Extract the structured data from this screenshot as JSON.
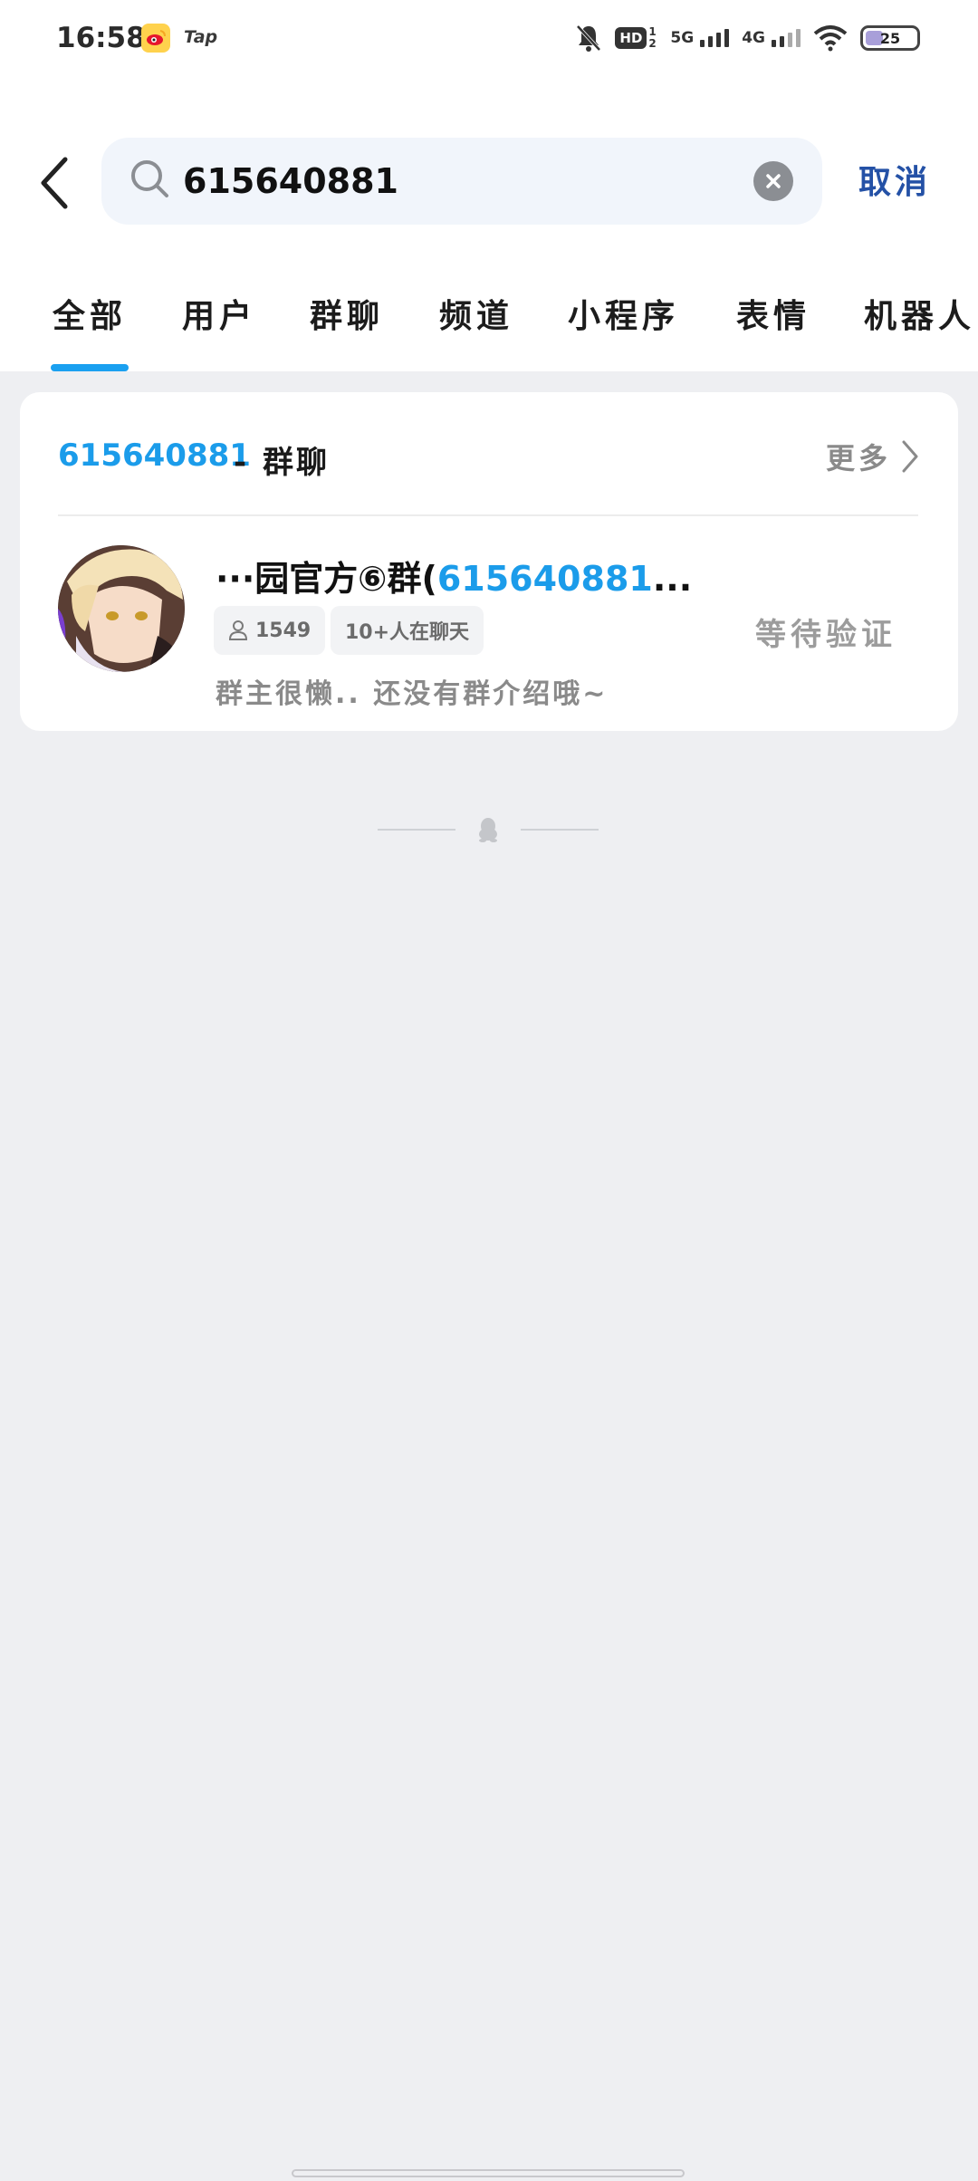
{
  "status_bar": {
    "time": "16:58",
    "tap_label": "Tap",
    "hd_label": "HD",
    "hd_sub": "1 2",
    "net1": "5G",
    "net2": "4G",
    "battery": "25"
  },
  "search": {
    "query": "615640881",
    "cancel_label": "取消"
  },
  "tabs": [
    {
      "label": "全部",
      "active": true
    },
    {
      "label": "用户"
    },
    {
      "label": "群聊"
    },
    {
      "label": "频道"
    },
    {
      "label": "小程序"
    },
    {
      "label": "表情"
    },
    {
      "label": "机器人"
    }
  ],
  "result_section": {
    "query": "615640881",
    "type_label": "- 群聊",
    "more_label": "更多",
    "group": {
      "name_prefix": "···园官方⑥群(",
      "name_highlight": "615640881",
      "name_suffix": "...",
      "member_count": "1549",
      "chatting_label": "10+人在聊天",
      "status": "等待验证",
      "description": "群主很懒.. 还没有群介绍哦~"
    }
  },
  "colors": {
    "accent": "#1b9cea",
    "cancel": "#2451a6",
    "background": "#eeeff2"
  }
}
